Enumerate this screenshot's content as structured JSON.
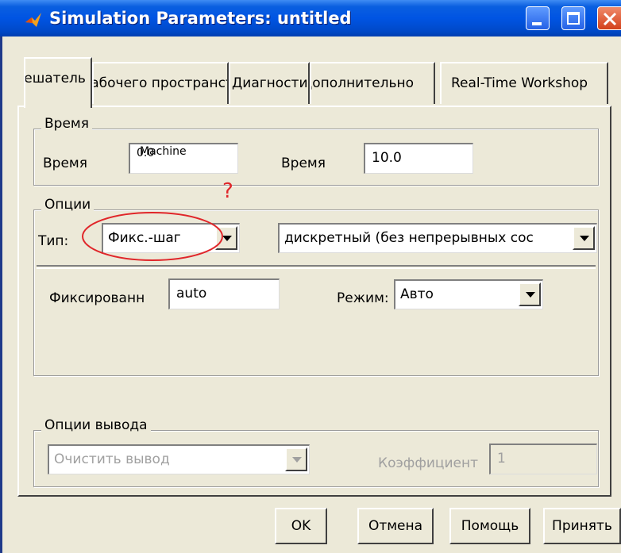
{
  "window": {
    "title": "Simulation Parameters: untitled"
  },
  "tabs": [
    {
      "label": "Решатель"
    },
    {
      "label": "Рабочего пространства"
    },
    {
      "label": "Диагностика"
    },
    {
      "label": "Дополнительно"
    },
    {
      "label": "Real-Time Workshop"
    }
  ],
  "time_group": {
    "legend": "Время",
    "start_label": "Время",
    "start_value": "0.0",
    "start_overlay": "Machine",
    "stop_label": "Время",
    "stop_value": "10.0"
  },
  "options_group": {
    "legend": "Опции",
    "type_label": "Тип:",
    "type_value": "Фикс.-шаг",
    "solver_value": "дискретный (без непрерывных сос",
    "annotation_mark": "?",
    "fixed_step_label": "Фиксированн",
    "fixed_step_value": "auto",
    "mode_label": "Режим:",
    "mode_value": "Авто"
  },
  "output_group": {
    "legend": "Опции вывода",
    "output_value": "Очистить вывод",
    "factor_label": "Коэффициент",
    "factor_value": "1"
  },
  "buttons": {
    "ok": "OK",
    "cancel": "Отмена",
    "help": "Помощь",
    "apply": "Принять"
  },
  "colors": {
    "titlebar": "#0054e3",
    "face": "#ece9d8",
    "annotation": "#e0262a"
  }
}
